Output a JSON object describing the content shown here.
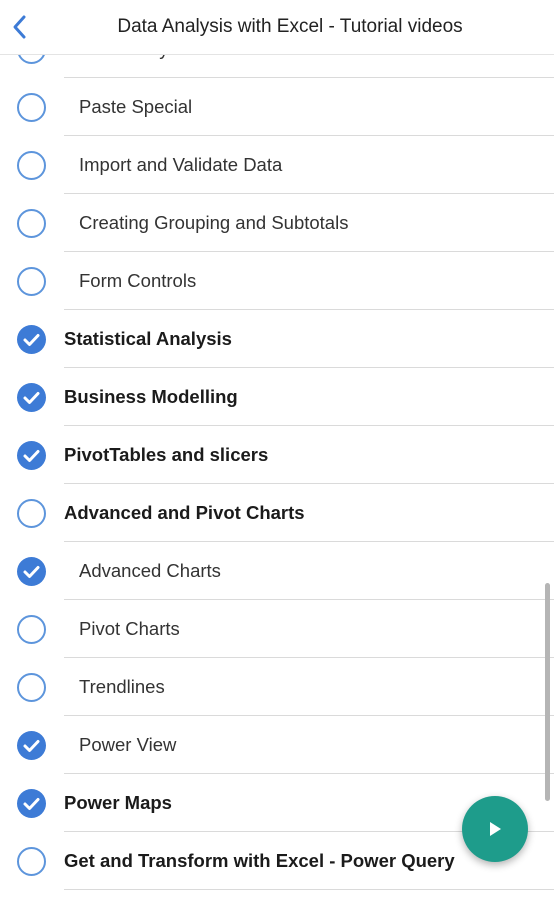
{
  "header": {
    "title": "Data Analysis with Excel - Tutorial videos",
    "back_icon": "chevron-left-icon"
  },
  "items": [
    {
      "label": "Data Analysis Tool Pak",
      "kind": "sub",
      "checked": false
    },
    {
      "label": "Paste Special",
      "kind": "sub",
      "checked": false
    },
    {
      "label": "Import and Validate Data",
      "kind": "sub",
      "checked": false
    },
    {
      "label": "Creating Grouping and Subtotals",
      "kind": "sub",
      "checked": false
    },
    {
      "label": "Form Controls",
      "kind": "sub",
      "checked": false
    },
    {
      "label": "Statistical Analysis",
      "kind": "section",
      "checked": true
    },
    {
      "label": "Business Modelling",
      "kind": "section",
      "checked": true
    },
    {
      "label": "PivotTables and slicers",
      "kind": "section",
      "checked": true
    },
    {
      "label": "Advanced and Pivot Charts",
      "kind": "section",
      "checked": false
    },
    {
      "label": "Advanced Charts",
      "kind": "sub",
      "checked": true
    },
    {
      "label": "Pivot Charts",
      "kind": "sub",
      "checked": false
    },
    {
      "label": "Trendlines",
      "kind": "sub",
      "checked": false
    },
    {
      "label": "Power View",
      "kind": "sub",
      "checked": true
    },
    {
      "label": "Power Maps",
      "kind": "section",
      "checked": true
    },
    {
      "label": "Get and Transform with Excel - Power Query",
      "kind": "section",
      "checked": false
    }
  ],
  "fab": {
    "icon": "play-icon"
  },
  "colors": {
    "accent": "#3d7bd6",
    "unchecked_ring": "#5d95dc",
    "fab": "#1e9c8b",
    "divider": "#dadada",
    "text": "#222222"
  }
}
